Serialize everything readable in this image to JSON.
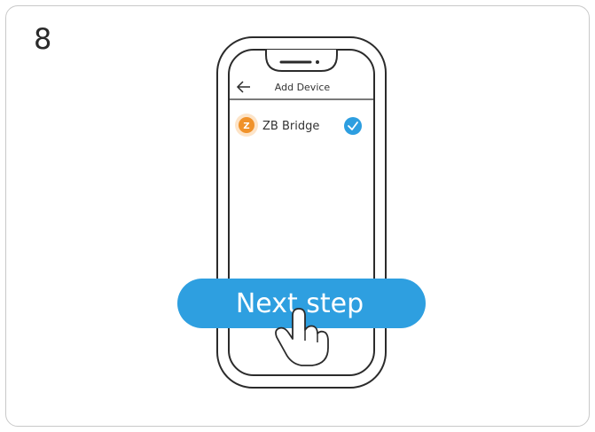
{
  "step": {
    "number": "8"
  },
  "screen": {
    "title": "Add Device",
    "back_icon": "arrow-left-icon"
  },
  "device": {
    "name": "ZB Bridge",
    "icon": "zigbee-logo-icon",
    "icon_letter": "Z",
    "selected": true,
    "check_icon": "checkmark-icon"
  },
  "action": {
    "next_label": "Next step",
    "pointer_icon": "hand-pointer-icon"
  },
  "colors": {
    "accent": "#2d9ee0",
    "button": "#2e9fe0",
    "zigbee_orange": "#f0922a",
    "outline": "#2b2b2b"
  }
}
